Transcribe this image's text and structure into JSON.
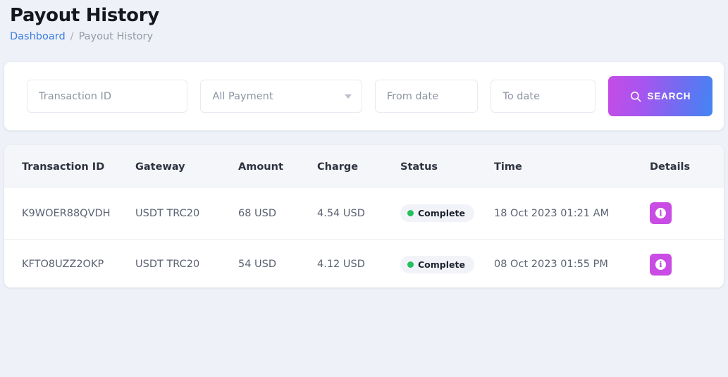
{
  "header": {
    "title": "Payout History",
    "breadcrumb": {
      "link": "Dashboard",
      "separator": "/",
      "current": "Payout History"
    }
  },
  "filters": {
    "transaction_id_placeholder": "Transaction ID",
    "payment_select_value": "All Payment",
    "from_date_placeholder": "From date",
    "to_date_placeholder": "To date",
    "search_label": "SEARCH"
  },
  "table": {
    "columns": [
      "Transaction ID",
      "Gateway",
      "Amount",
      "Charge",
      "Status",
      "Time",
      "Details"
    ],
    "rows": [
      {
        "transaction_id": "K9WOER88QVDH",
        "gateway": "USDT TRC20",
        "amount": "68 USD",
        "charge": "4.54 USD",
        "status": "Complete",
        "time": "18 Oct 2023 01:21 AM",
        "details_icon": "info-icon"
      },
      {
        "transaction_id": "KFTO8UZZ2OKP",
        "gateway": "USDT TRC20",
        "amount": "54 USD",
        "charge": "4.12 USD",
        "status": "Complete",
        "time": "08 Oct 2023 01:55 PM",
        "details_icon": "info-icon"
      }
    ]
  },
  "colors": {
    "page_background": "#eef1f7",
    "accent_purple": "#c94ce4",
    "accent_blue": "#4285f4",
    "link_blue": "#3b7ddd",
    "status_green": "#22c15e",
    "card_white": "#ffffff",
    "table_header": "#f4f6fa"
  }
}
